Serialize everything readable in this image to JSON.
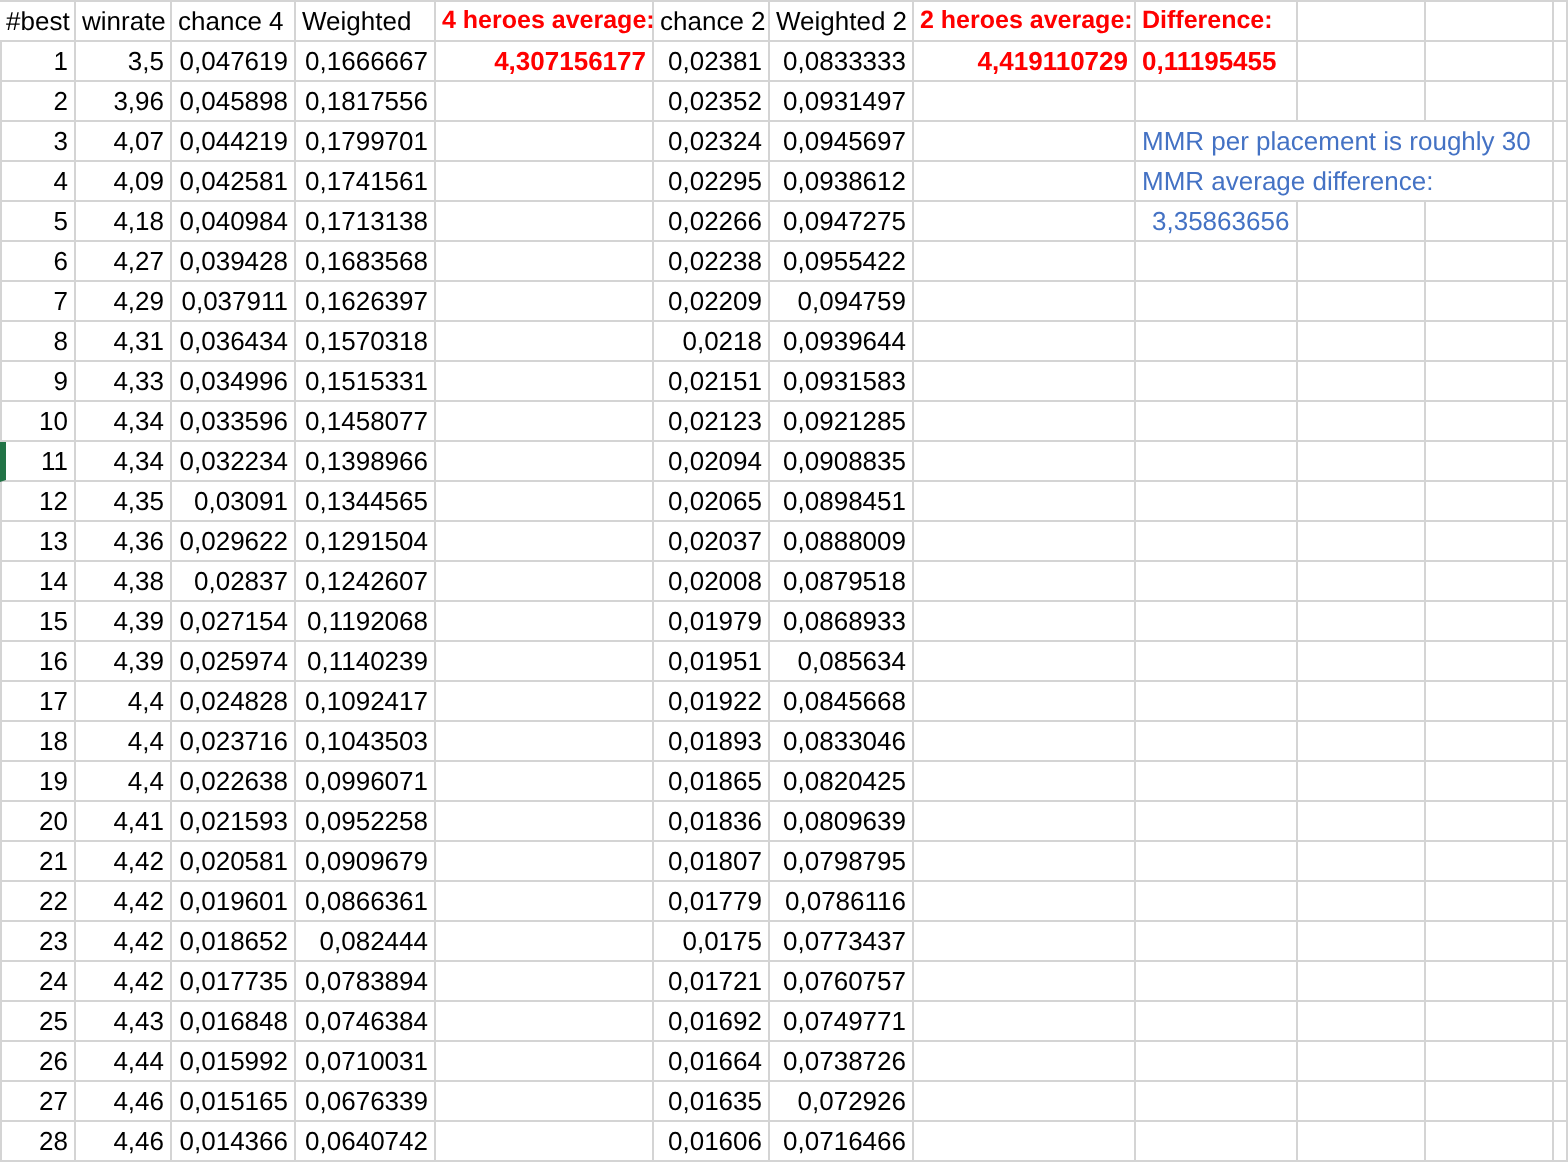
{
  "header": [
    {
      "text": "#best",
      "kind": "label"
    },
    {
      "text": "winrate",
      "kind": "label"
    },
    {
      "text": "chance 4",
      "kind": "label"
    },
    {
      "text": "Weighted",
      "kind": "label"
    },
    {
      "text": "4 heroes average:",
      "kind": "result"
    },
    {
      "text": "chance 2",
      "kind": "label"
    },
    {
      "text": "Weighted 2",
      "kind": "label"
    },
    {
      "text": "2 heroes average:",
      "kind": "result"
    },
    {
      "text": "Difference:",
      "kind": "result"
    }
  ],
  "results": {
    "heroes_4_average": "4,307156177",
    "heroes_2_average": "4,419110729",
    "difference": "0,11195455"
  },
  "notes": [
    "MMR per placement is roughly 30",
    "MMR average difference:",
    "3,35863656"
  ],
  "rows": [
    {
      "best": "1",
      "winrate": "3,5",
      "chance_4": "0,047619",
      "weighted": "0,1666667",
      "chance_2": "0,02381",
      "weighted_2": "0,0833333",
      "selected": false
    },
    {
      "best": "2",
      "winrate": "3,96",
      "chance_4": "0,045898",
      "weighted": "0,1817556",
      "chance_2": "0,02352",
      "weighted_2": "0,0931497",
      "selected": false
    },
    {
      "best": "3",
      "winrate": "4,07",
      "chance_4": "0,044219",
      "weighted": "0,1799701",
      "chance_2": "0,02324",
      "weighted_2": "0,0945697",
      "selected": false
    },
    {
      "best": "4",
      "winrate": "4,09",
      "chance_4": "0,042581",
      "weighted": "0,1741561",
      "chance_2": "0,02295",
      "weighted_2": "0,0938612",
      "selected": false
    },
    {
      "best": "5",
      "winrate": "4,18",
      "chance_4": "0,040984",
      "weighted": "0,1713138",
      "chance_2": "0,02266",
      "weighted_2": "0,0947275",
      "selected": false
    },
    {
      "best": "6",
      "winrate": "4,27",
      "chance_4": "0,039428",
      "weighted": "0,1683568",
      "chance_2": "0,02238",
      "weighted_2": "0,0955422",
      "selected": false
    },
    {
      "best": "7",
      "winrate": "4,29",
      "chance_4": "0,037911",
      "weighted": "0,1626397",
      "chance_2": "0,02209",
      "weighted_2": "0,094759",
      "selected": false
    },
    {
      "best": "8",
      "winrate": "4,31",
      "chance_4": "0,036434",
      "weighted": "0,1570318",
      "chance_2": "0,0218",
      "weighted_2": "0,0939644",
      "selected": false
    },
    {
      "best": "9",
      "winrate": "4,33",
      "chance_4": "0,034996",
      "weighted": "0,1515331",
      "chance_2": "0,02151",
      "weighted_2": "0,0931583",
      "selected": false
    },
    {
      "best": "10",
      "winrate": "4,34",
      "chance_4": "0,033596",
      "weighted": "0,1458077",
      "chance_2": "0,02123",
      "weighted_2": "0,0921285",
      "selected": false
    },
    {
      "best": "11",
      "winrate": "4,34",
      "chance_4": "0,032234",
      "weighted": "0,1398966",
      "chance_2": "0,02094",
      "weighted_2": "0,0908835",
      "selected": true
    },
    {
      "best": "12",
      "winrate": "4,35",
      "chance_4": "0,03091",
      "weighted": "0,1344565",
      "chance_2": "0,02065",
      "weighted_2": "0,0898451",
      "selected": false
    },
    {
      "best": "13",
      "winrate": "4,36",
      "chance_4": "0,029622",
      "weighted": "0,1291504",
      "chance_2": "0,02037",
      "weighted_2": "0,0888009",
      "selected": false
    },
    {
      "best": "14",
      "winrate": "4,38",
      "chance_4": "0,02837",
      "weighted": "0,1242607",
      "chance_2": "0,02008",
      "weighted_2": "0,0879518",
      "selected": false
    },
    {
      "best": "15",
      "winrate": "4,39",
      "chance_4": "0,027154",
      "weighted": "0,1192068",
      "chance_2": "0,01979",
      "weighted_2": "0,0868933",
      "selected": false
    },
    {
      "best": "16",
      "winrate": "4,39",
      "chance_4": "0,025974",
      "weighted": "0,1140239",
      "chance_2": "0,01951",
      "weighted_2": "0,085634",
      "selected": false
    },
    {
      "best": "17",
      "winrate": "4,4",
      "chance_4": "0,024828",
      "weighted": "0,1092417",
      "chance_2": "0,01922",
      "weighted_2": "0,0845668",
      "selected": false
    },
    {
      "best": "18",
      "winrate": "4,4",
      "chance_4": "0,023716",
      "weighted": "0,1043503",
      "chance_2": "0,01893",
      "weighted_2": "0,0833046",
      "selected": false
    },
    {
      "best": "19",
      "winrate": "4,4",
      "chance_4": "0,022638",
      "weighted": "0,0996071",
      "chance_2": "0,01865",
      "weighted_2": "0,0820425",
      "selected": false
    },
    {
      "best": "20",
      "winrate": "4,41",
      "chance_4": "0,021593",
      "weighted": "0,0952258",
      "chance_2": "0,01836",
      "weighted_2": "0,0809639",
      "selected": false
    },
    {
      "best": "21",
      "winrate": "4,42",
      "chance_4": "0,020581",
      "weighted": "0,0909679",
      "chance_2": "0,01807",
      "weighted_2": "0,0798795",
      "selected": false
    },
    {
      "best": "22",
      "winrate": "4,42",
      "chance_4": "0,019601",
      "weighted": "0,0866361",
      "chance_2": "0,01779",
      "weighted_2": "0,0786116",
      "selected": false
    },
    {
      "best": "23",
      "winrate": "4,42",
      "chance_4": "0,018652",
      "weighted": "0,082444",
      "chance_2": "0,0175",
      "weighted_2": "0,0773437",
      "selected": false
    },
    {
      "best": "24",
      "winrate": "4,42",
      "chance_4": "0,017735",
      "weighted": "0,0783894",
      "chance_2": "0,01721",
      "weighted_2": "0,0760757",
      "selected": false
    },
    {
      "best": "25",
      "winrate": "4,43",
      "chance_4": "0,016848",
      "weighted": "0,0746384",
      "chance_2": "0,01692",
      "weighted_2": "0,0749771",
      "selected": false
    },
    {
      "best": "26",
      "winrate": "4,44",
      "chance_4": "0,015992",
      "weighted": "0,0710031",
      "chance_2": "0,01664",
      "weighted_2": "0,0738726",
      "selected": false
    },
    {
      "best": "27",
      "winrate": "4,46",
      "chance_4": "0,015165",
      "weighted": "0,0676339",
      "chance_2": "0,01635",
      "weighted_2": "0,072926",
      "selected": false
    },
    {
      "best": "28",
      "winrate": "4,46",
      "chance_4": "0,014366",
      "weighted": "0,0640742",
      "chance_2": "0,01606",
      "weighted_2": "0,0716466",
      "selected": false
    }
  ]
}
